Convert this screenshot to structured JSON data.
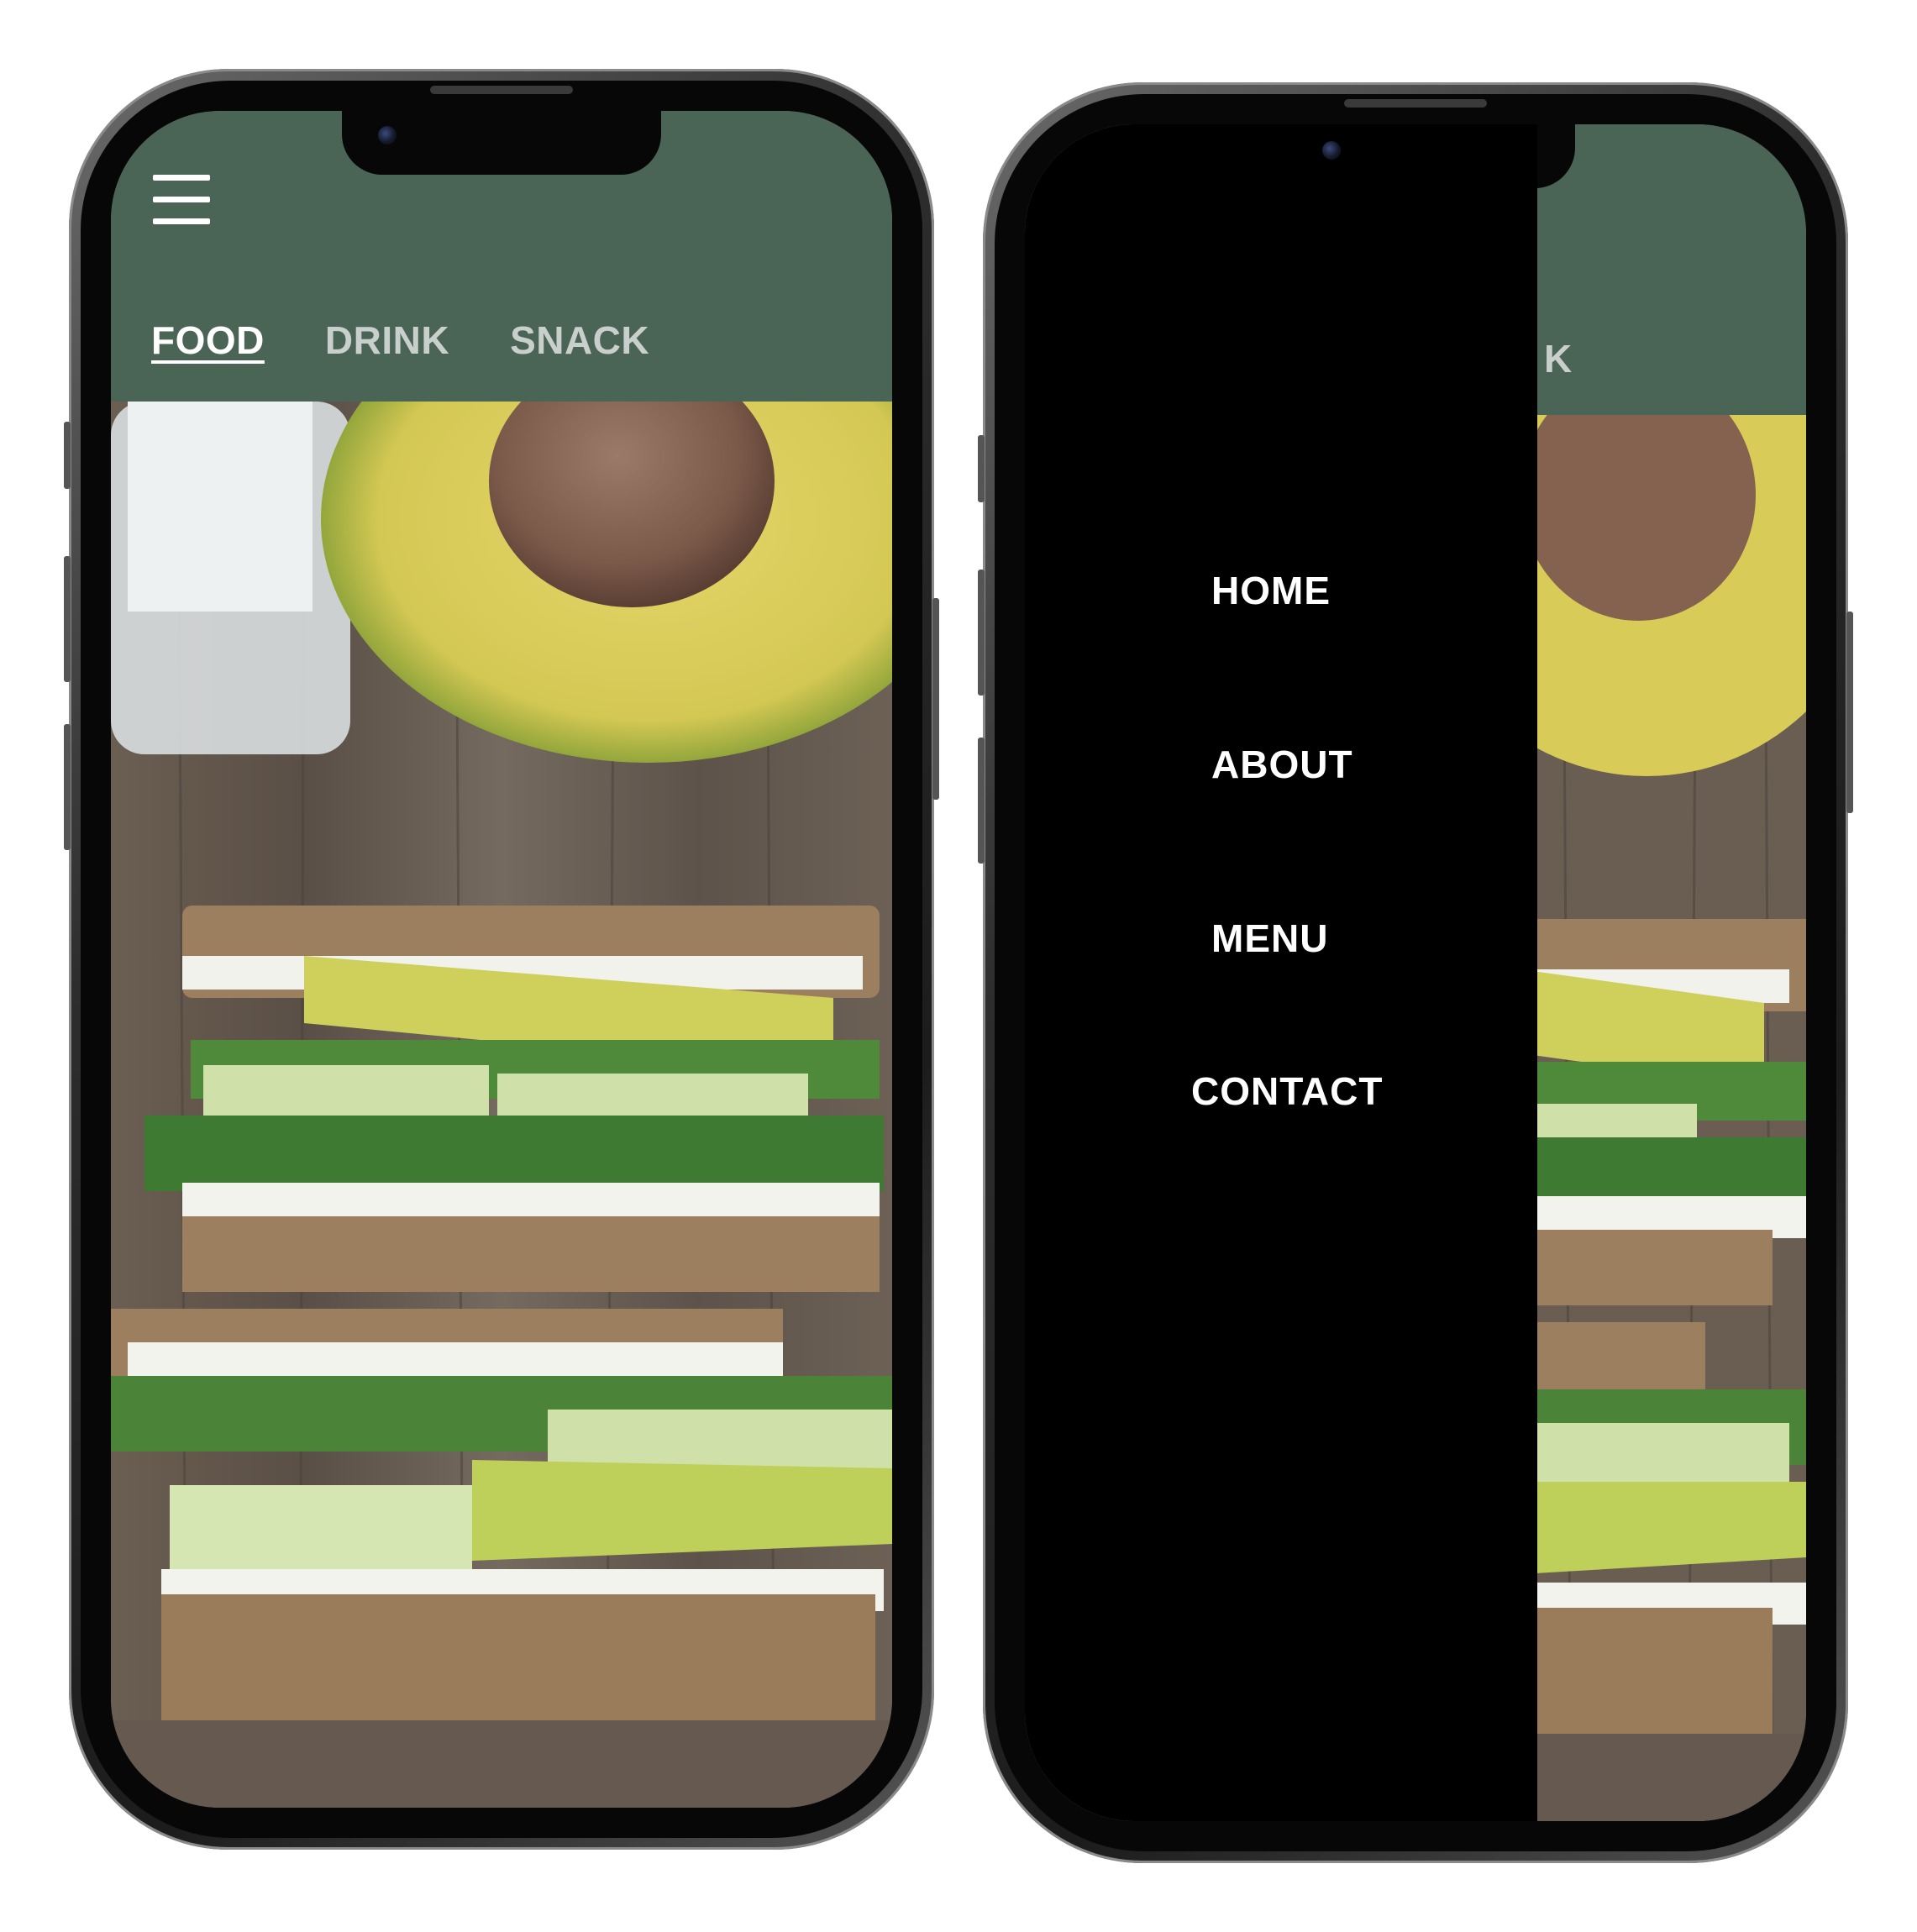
{
  "colors": {
    "header_green": "#4a6556",
    "drawer_bg": "#000000",
    "tab_active": "#ffffff",
    "tab_inactive": "#c9cfcc"
  },
  "left_phone": {
    "menu_icon": "hamburger-icon",
    "tabs": [
      {
        "label": "FOOD",
        "active": true
      },
      {
        "label": "DRINK",
        "active": false
      },
      {
        "label": "SNACK",
        "active": false
      }
    ],
    "hero_image": "avocado-sandwich-photo"
  },
  "right_phone": {
    "partial_tab_text": "K",
    "drawer": {
      "items": [
        {
          "label": "HOME"
        },
        {
          "label": "ABOUT"
        },
        {
          "label": "MENU"
        },
        {
          "label": "CONTACT"
        }
      ]
    },
    "hero_image": "avocado-sandwich-photo"
  }
}
